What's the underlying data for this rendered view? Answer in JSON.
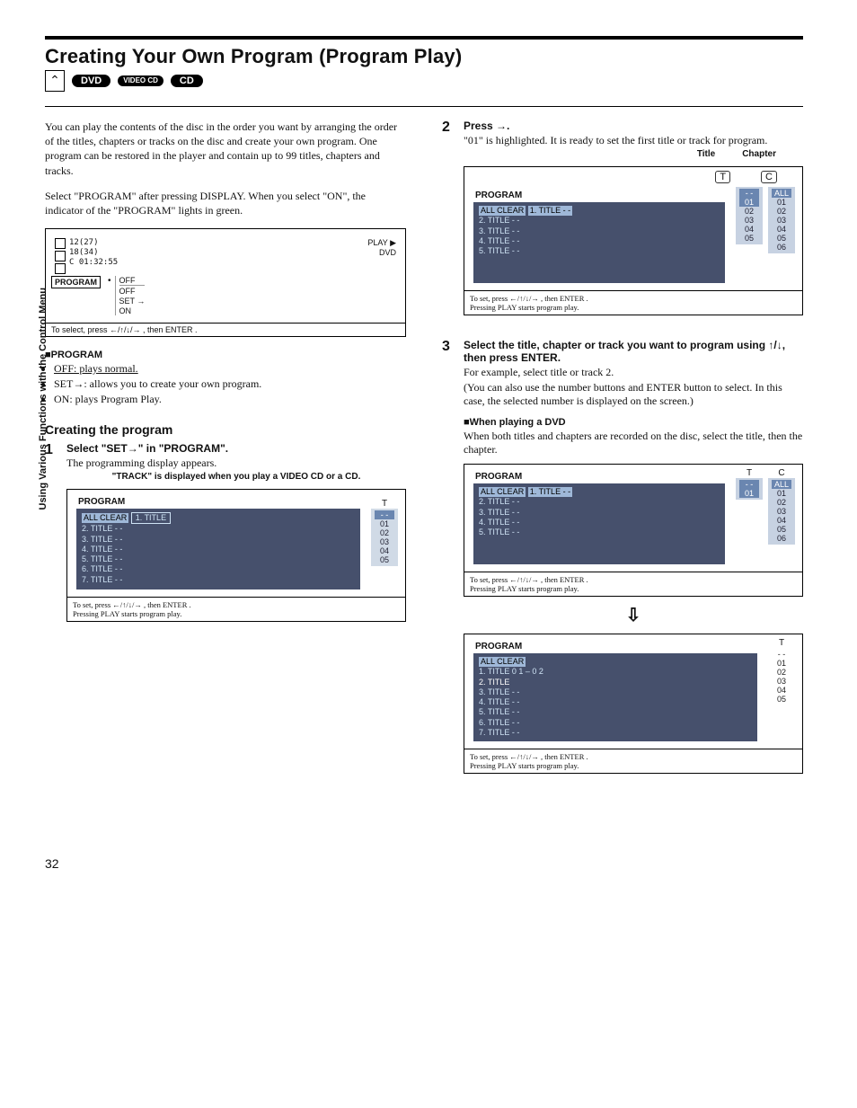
{
  "sideTab": "Using Various Functions with the Control Menu",
  "title": "Creating Your Own Program (Program Play)",
  "mediaBadges": {
    "dvd": "DVD",
    "vcd": "VIDEO CD",
    "cd": "CD"
  },
  "intro1": "You can play the contents of the disc in the order you want by arranging the order of the titles, chapters or tracks on the disc and create your own program. One program can be restored in the player and contain up to 99 titles, chapters and tracks.",
  "intro2": "Select \"PROGRAM\" after pressing DISPLAY. When you select \"ON\", the indicator of the \"PROGRAM\" lights in green.",
  "osd1": {
    "label": "PROGRAM",
    "lines": [
      "12(27)",
      "18(34)",
      "C   01:32:55"
    ],
    "rightTop": "PLAY ▶",
    "rightSub": "DVD",
    "options": [
      "OFF",
      "OFF",
      "SET →",
      "ON"
    ],
    "footer": "To select, press ←/↑/↓/→ , then ENTER ."
  },
  "programHeader": "■PROGRAM",
  "programBullets": [
    "OFF: plays normal.",
    "SET→: allows you to create your own program.",
    "ON: plays Program Play."
  ],
  "createHeader": "Creating the program",
  "step1": {
    "lead": "Select \"SET→\" in \"PROGRAM\".",
    "body": "The programming display appears.",
    "caption": "\"TRACK\" is displayed when you play a VIDEO CD or a CD."
  },
  "screenA": {
    "head": "PROGRAM",
    "colLabel": "T",
    "allClear": "ALL CLEAR",
    "items": [
      "1. TITLE",
      "2. TITLE  - -",
      "3. TITLE  - -",
      "4. TITLE  - -",
      "5. TITLE  - -",
      "6. TITLE  - -",
      "7. TITLE  - -"
    ],
    "nums": [
      "- -",
      "01",
      "02",
      "03",
      "04",
      "05"
    ],
    "footer1": "To set, press ←/↑/↓/→ , then ENTER .",
    "footer2": "Pressing PLAY starts program play."
  },
  "step2": {
    "lead": "Press →.",
    "body": "\"01\" is highlighted. It is ready to set the first title or track for program."
  },
  "tcLabels": {
    "title": "Title",
    "chapter": "Chapter",
    "t": "T",
    "c": "C"
  },
  "screenB": {
    "head": "PROGRAM",
    "items": [
      "ALL CLEAR",
      "1. TITLE  - -",
      "2. TITLE  - -",
      "3. TITLE  - -",
      "4. TITLE  - -",
      "5. TITLE  - -"
    ],
    "tcol": [
      "- -",
      "01",
      "02",
      "03",
      "04",
      "05"
    ],
    "ccol": [
      "ALL",
      "01",
      "02",
      "03",
      "04",
      "05",
      "06"
    ],
    "footer1": "To set, press ←/↑/↓/→ , then ENTER .",
    "footer2": "Pressing PLAY starts program play."
  },
  "step3": {
    "lead": "Select the title, chapter or track you want to program using ↑/↓, then press ENTER.",
    "body1": "For example, select title or track 2.",
    "body2": "(You can also use the number buttons and ENTER button to select. In this case, the selected number is displayed on the screen.)"
  },
  "dvdHeader": "■When playing a DVD",
  "dvdBody": "When both titles and chapters are recorded on the disc, select the title, then the chapter.",
  "screenC": {
    "head": "PROGRAM",
    "tLabel": "T",
    "cLabel": "C",
    "items": [
      "ALL CLEAR",
      "1. TITLE  - -",
      "2. TITLE  - -",
      "3. TITLE  - -",
      "4. TITLE  - -",
      "5. TITLE  - -"
    ],
    "tcol": [
      "- -",
      "01"
    ],
    "ccol": [
      "ALL",
      "01",
      "02",
      "03",
      "04",
      "05",
      "06"
    ],
    "footer1": "To set, press ←/↑/↓/→ , then ENTER .",
    "footer2": "Pressing PLAY starts program play."
  },
  "screenD": {
    "head": "PROGRAM",
    "tLabel": "T",
    "items": [
      "ALL CLEAR",
      "1. TITLE  0 1 – 0 2",
      "2. TITLE",
      "3. TITLE  - -",
      "4. TITLE  - -",
      "5. TITLE  - -",
      "6. TITLE  - -",
      "7. TITLE  - -"
    ],
    "tcol": [
      "- -",
      "01",
      "02",
      "03",
      "04",
      "05"
    ],
    "footer1": "To set, press ←/↑/↓/→ , then ENTER .",
    "footer2": "Pressing PLAY starts program play."
  },
  "pageNum": "32"
}
